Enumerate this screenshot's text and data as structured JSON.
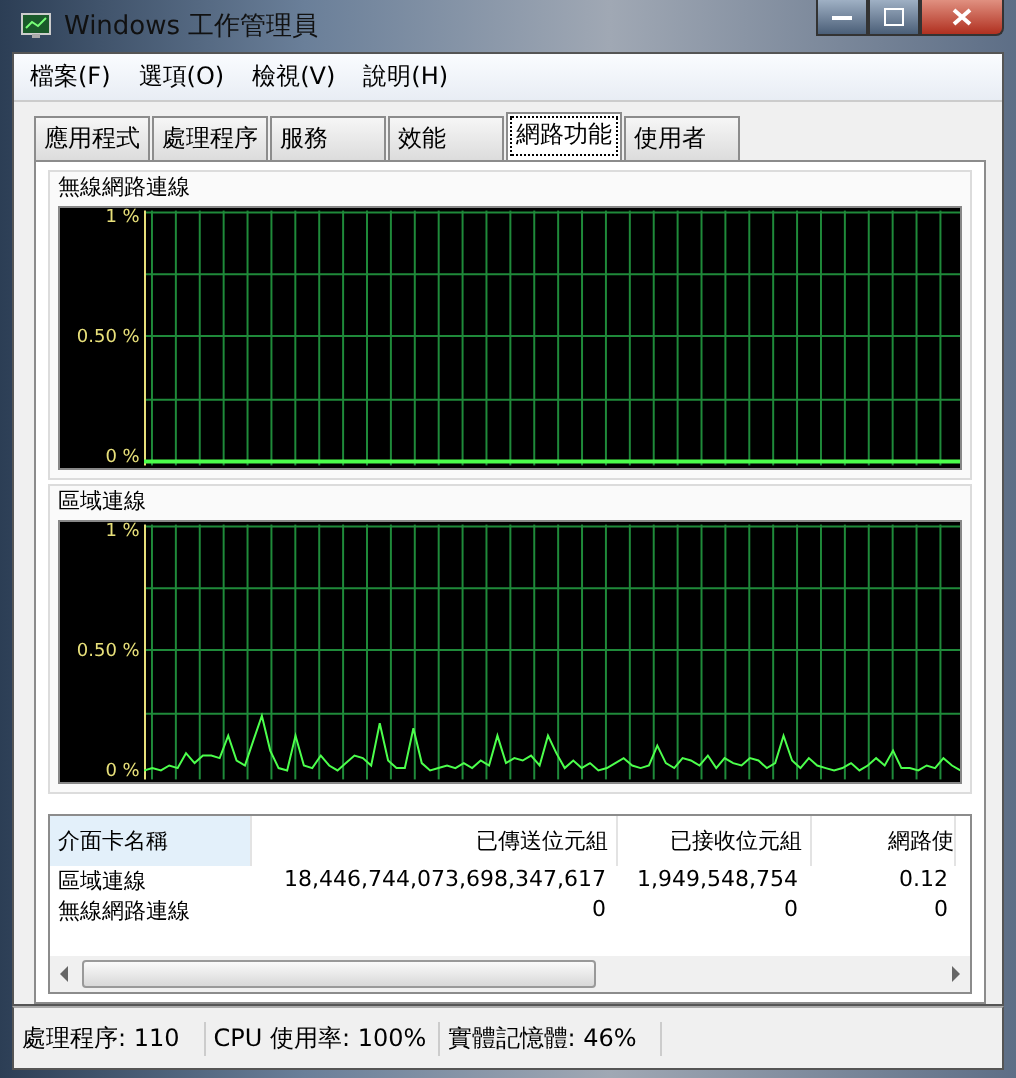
{
  "window": {
    "title": "Windows 工作管理員"
  },
  "menu": [
    "檔案(F)",
    "選項(O)",
    "檢視(V)",
    "說明(H)"
  ],
  "tabs": [
    {
      "label": "應用程式",
      "selected": false
    },
    {
      "label": "處理程序",
      "selected": false
    },
    {
      "label": "服務",
      "selected": false
    },
    {
      "label": "效能",
      "selected": false
    },
    {
      "label": "網路功能",
      "selected": true
    },
    {
      "label": "使用者",
      "selected": false
    }
  ],
  "graphs": [
    {
      "title": "無線網路連線",
      "ticks": [
        "1 %",
        "0.50 %",
        "0 %"
      ],
      "active": false
    },
    {
      "title": "區域連線",
      "ticks": [
        "1 %",
        "0.50 %",
        "0 %"
      ],
      "active": true
    }
  ],
  "table": {
    "columns": [
      "介面卡名稱",
      "已傳送位元組",
      "已接收位元組",
      "網路使"
    ],
    "rows": [
      [
        "區域連線",
        "18,446,744,073,698,347,617",
        "1,949,548,754",
        "0.12"
      ],
      [
        "無線網路連線",
        "0",
        "0",
        "0"
      ]
    ]
  },
  "status_bar": [
    "處理程序: 110",
    "CPU 使用率: 100%",
    "實體記憶體: 46%"
  ]
}
